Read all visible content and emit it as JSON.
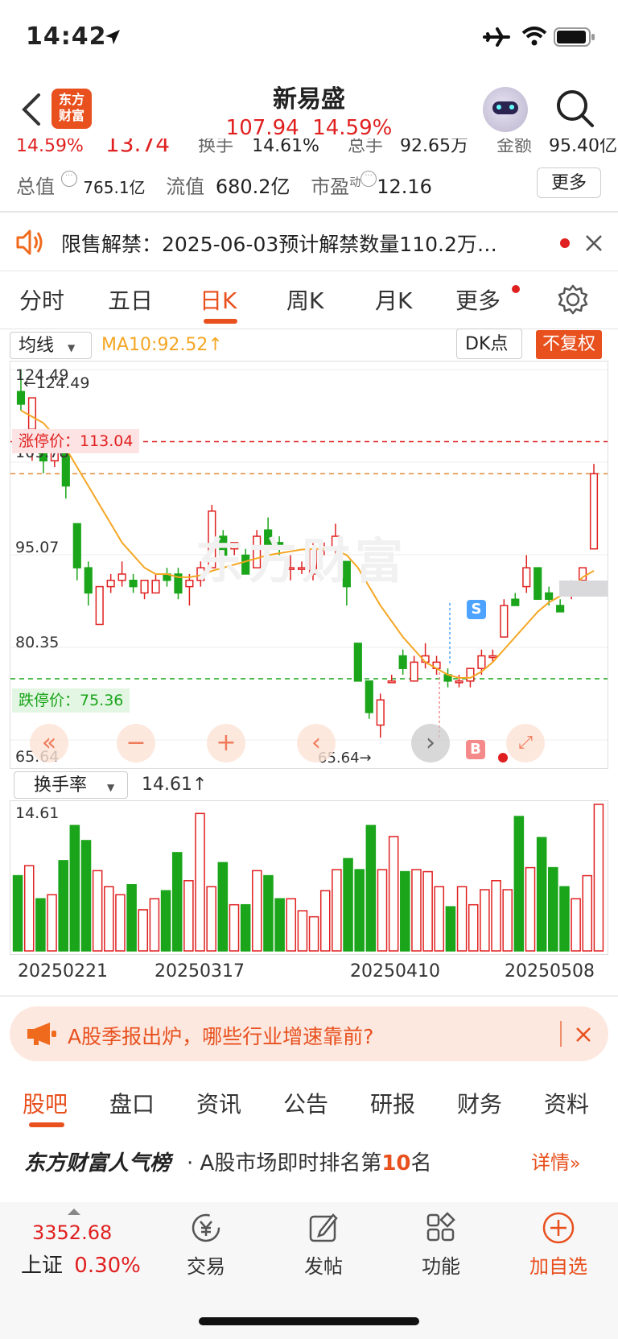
{
  "status": {
    "time": "14:42"
  },
  "header": {
    "logo_text_line1": "东方",
    "logo_text_line2": "财富",
    "title": "新易盛",
    "price": "107.94",
    "change_pct": "14.59%"
  },
  "quote": {
    "row1": {
      "pct": "14.59%",
      "val": "13.74",
      "turnover_label": "换手",
      "turnover": "14.61%",
      "vol_label": "总手",
      "vol": "92.65万",
      "amount_label": "金额",
      "amount": "95.40亿"
    },
    "row2": {
      "mktcap_label": "总值",
      "mktcap": "765.1亿",
      "float_label": "流值",
      "float": "680.2亿",
      "pe_label": "市盈",
      "pe_super": "动",
      "pe": "12.16"
    },
    "more_label": "更多"
  },
  "notice": {
    "text": "限售解禁：2025-06-03预计解禁数量110.2万…"
  },
  "chart_tabs": [
    "分时",
    "五日",
    "日K",
    "周K",
    "月K",
    "更多"
  ],
  "chart_tab_active": "日K",
  "chart_toolbar": {
    "ma_select": "均线",
    "ma_value": "MA10:92.52↑",
    "dk_label": "DK点",
    "fuquan_label": "不复权"
  },
  "kline": {
    "ticks": [
      "124.49",
      "109.78",
      "95.07",
      "80.35",
      "65.64"
    ],
    "high_label": "←124.49",
    "low_label": "65.64→",
    "limit_up_label": "涨停价：113.04",
    "limit_down_label": "跌停价：75.36",
    "buy_marker": "B",
    "sell_marker": "S"
  },
  "volume": {
    "select_label": "换手率",
    "value": "14.61↑",
    "tick_max": "14.61",
    "dates": [
      "20250221",
      "20250317",
      "20250410",
      "20250508"
    ]
  },
  "chart_data": {
    "type": "candlestick",
    "ylim": [
      65.64,
      124.49
    ],
    "limit_up": 113.04,
    "limit_down": 75.36,
    "candles": [
      {
        "o": 121,
        "c": 119,
        "h": 124.49,
        "l": 118
      },
      {
        "o": 115,
        "c": 120,
        "h": 120,
        "l": 110
      },
      {
        "o": 112,
        "c": 110,
        "h": 113,
        "l": 108
      },
      {
        "o": 110,
        "c": 113,
        "h": 114,
        "l": 109
      },
      {
        "o": 113,
        "c": 106,
        "h": 113,
        "l": 104
      },
      {
        "o": 100,
        "c": 93,
        "h": 100,
        "l": 91
      },
      {
        "o": 93,
        "c": 89,
        "h": 94,
        "l": 87
      },
      {
        "o": 84,
        "c": 90,
        "h": 90,
        "l": 84
      },
      {
        "o": 90,
        "c": 91,
        "h": 92,
        "l": 89
      },
      {
        "o": 91,
        "c": 92,
        "h": 94,
        "l": 90
      },
      {
        "o": 91,
        "c": 90,
        "h": 92,
        "l": 89
      },
      {
        "o": 89,
        "c": 91,
        "h": 91,
        "l": 88
      },
      {
        "o": 89,
        "c": 91,
        "h": 92,
        "l": 89
      },
      {
        "o": 92,
        "c": 91,
        "h": 93,
        "l": 90
      },
      {
        "o": 92,
        "c": 89,
        "h": 93,
        "l": 88
      },
      {
        "o": 90,
        "c": 91,
        "h": 92,
        "l": 87
      },
      {
        "o": 91,
        "c": 93,
        "h": 94,
        "l": 90
      },
      {
        "o": 93,
        "c": 102,
        "h": 103,
        "l": 93
      },
      {
        "o": 98,
        "c": 95,
        "h": 99,
        "l": 94
      },
      {
        "o": 96,
        "c": 97,
        "h": 97,
        "l": 95
      },
      {
        "o": 95,
        "c": 92,
        "h": 96,
        "l": 92
      },
      {
        "o": 93,
        "c": 98,
        "h": 99,
        "l": 93
      },
      {
        "o": 99,
        "c": 96,
        "h": 101,
        "l": 95
      },
      {
        "o": 97,
        "c": 96,
        "h": 98,
        "l": 95
      },
      {
        "o": 93,
        "c": 93,
        "h": 95,
        "l": 91
      },
      {
        "o": 93,
        "c": 93,
        "h": 94,
        "l": 92
      },
      {
        "o": 92,
        "c": 96,
        "h": 97,
        "l": 91
      },
      {
        "o": 96,
        "c": 96,
        "h": 97,
        "l": 95
      },
      {
        "o": 96,
        "c": 98,
        "h": 100,
        "l": 95
      },
      {
        "o": 94,
        "c": 90,
        "h": 94,
        "l": 87
      },
      {
        "o": 81,
        "c": 75,
        "h": 81,
        "l": 75
      },
      {
        "o": 75,
        "c": 70,
        "h": 75,
        "l": 69
      },
      {
        "o": 68,
        "c": 72,
        "h": 73,
        "l": 66
      },
      {
        "o": 75,
        "c": 75,
        "h": 76,
        "l": 75
      },
      {
        "o": 79,
        "c": 77,
        "h": 80,
        "l": 76
      },
      {
        "o": 75,
        "c": 78,
        "h": 79,
        "l": 75
      },
      {
        "o": 78,
        "c": 79,
        "h": 81,
        "l": 77
      },
      {
        "o": 77,
        "c": 78,
        "h": 79,
        "l": 76
      },
      {
        "o": 76,
        "c": 75,
        "h": 77,
        "l": 74
      },
      {
        "o": 75,
        "c": 75,
        "h": 76,
        "l": 74
      },
      {
        "o": 75,
        "c": 77,
        "h": 77,
        "l": 74
      },
      {
        "o": 77,
        "c": 79,
        "h": 80,
        "l": 76
      },
      {
        "o": 79,
        "c": 79,
        "h": 80,
        "l": 78
      },
      {
        "o": 82,
        "c": 87,
        "h": 88,
        "l": 82
      },
      {
        "o": 88,
        "c": 87,
        "h": 89,
        "l": 87
      },
      {
        "o": 90,
        "c": 93,
        "h": 95,
        "l": 89
      },
      {
        "o": 93,
        "c": 88,
        "h": 93,
        "l": 88
      },
      {
        "o": 89,
        "c": 88,
        "h": 90,
        "l": 87
      },
      {
        "o": 87,
        "c": 86,
        "h": 88,
        "l": 86
      },
      {
        "o": 89,
        "c": 90,
        "h": 91,
        "l": 88
      },
      {
        "o": 91,
        "c": 93,
        "h": 93,
        "l": 90
      },
      {
        "o": 96,
        "c": 107.94,
        "h": 109.5,
        "l": 96
      }
    ],
    "ma10": [
      118,
      117,
      116,
      114,
      112,
      109,
      106,
      103,
      100,
      97,
      95,
      93,
      92,
      92,
      91.5,
      91.5,
      91.8,
      92.5,
      93,
      93.5,
      94,
      94.5,
      95,
      95.3,
      95.6,
      95.9,
      96,
      96,
      95.8,
      95,
      93,
      90,
      87,
      84.5,
      82,
      80,
      78,
      77,
      76,
      75.5,
      75.5,
      76.5,
      78,
      80,
      82,
      84,
      86,
      87.5,
      88.5,
      89.5,
      91.5,
      92.52
    ],
    "turnover": [
      7.5,
      8.5,
      5.2,
      5.6,
      9,
      12.5,
      11,
      8,
      6.4,
      5.6,
      6.6,
      4.1,
      5.2,
      6,
      9.8,
      7,
      13.7,
      6.4,
      8.8,
      4.6,
      4.6,
      8,
      7.5,
      5.2,
      5.2,
      4,
      3.4,
      6,
      8.1,
      9.2,
      8.1,
      12.5,
      8.1,
      11.4,
      7.9,
      8.1,
      7.9,
      6.4,
      4.4,
      6.4,
      4.6,
      6.1,
      7,
      6.1,
      13.4,
      8.3,
      11.3,
      8.3,
      6.4,
      5.2,
      7.5,
      14.61
    ],
    "ytick_turnover": [
      0,
      14.61
    ],
    "xdates": [
      "20250221",
      "20250317",
      "20250410",
      "20250508"
    ]
  },
  "banner": {
    "text": "A股季报出炉，哪些行业增速靠前?"
  },
  "content_tabs": [
    "股吧",
    "盘口",
    "资讯",
    "公告",
    "研报",
    "财务",
    "资料"
  ],
  "content_tab_active": "股吧",
  "popularity": {
    "brand": "东方财富人气榜",
    "prefix": "· A股市场即时排名第",
    "rank": "10",
    "suffix": "名",
    "detail": "详情"
  },
  "index": {
    "value": "3352.68",
    "name": "上证",
    "pct": "0.30%"
  },
  "nav": [
    "交易",
    "发帖",
    "功能",
    "加自选"
  ],
  "colors": {
    "up": "#e02020",
    "down": "#1aa51a",
    "accent": "#e8501e",
    "ma": "#f5a623"
  }
}
